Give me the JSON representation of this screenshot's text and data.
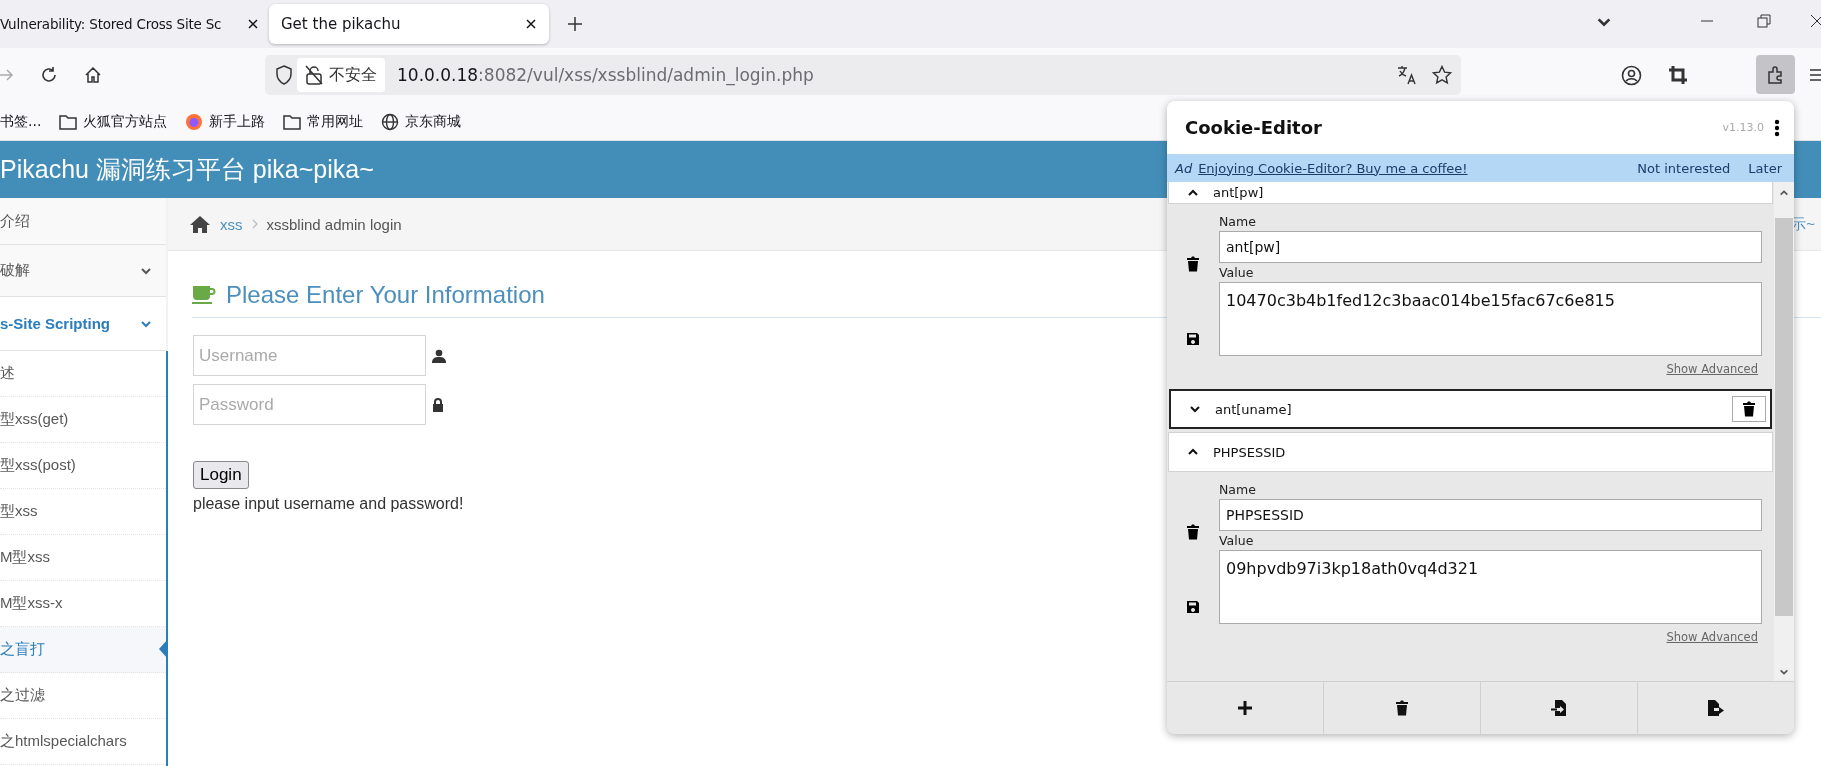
{
  "browser": {
    "tabs": [
      {
        "title": "Vulnerability: Stored Cross Site Sc",
        "selected": false
      },
      {
        "title": "Get the pikachu",
        "selected": true
      }
    ],
    "security_label": "不安全",
    "url_host": "10.0.0.18",
    "url_rest": ":8082/vul/xss/xssblind/admin_login.php",
    "bookmarks": [
      {
        "label": "书签...",
        "kind": "plain"
      },
      {
        "label": "火狐官方站点",
        "kind": "folder"
      },
      {
        "label": "新手上路",
        "kind": "firefox"
      },
      {
        "label": "常用网址",
        "kind": "folder"
      },
      {
        "label": "京东商城",
        "kind": "globe"
      }
    ]
  },
  "site": {
    "title": "Pikachu 漏洞练习平台 pika~pika~",
    "sidebar": [
      {
        "label": "介绍",
        "kind": "link",
        "selected": false
      },
      {
        "label": "破解",
        "kind": "group",
        "selected": false
      },
      {
        "label": "s-Site Scripting",
        "kind": "group",
        "selected": true,
        "children": [
          {
            "label": "述",
            "selected": false
          },
          {
            "label": "型xss(get)",
            "selected": false
          },
          {
            "label": "型xss(post)",
            "selected": false
          },
          {
            "label": "型xss",
            "selected": false
          },
          {
            "label": "M型xss",
            "selected": false
          },
          {
            "label": "M型xss-x",
            "selected": false
          },
          {
            "label": "之盲打",
            "selected": true
          },
          {
            "label": "之过滤",
            "selected": false
          },
          {
            "label": "之htmlspecialchars",
            "selected": false
          }
        ]
      }
    ],
    "breadcrumb": {
      "link": "xss",
      "current": "xssblind admin login",
      "trailing": "示~"
    },
    "form": {
      "heading": "Please Enter Your Information",
      "fields": [
        {
          "placeholder": "Username",
          "kind": "user"
        },
        {
          "placeholder": "Password",
          "kind": "password"
        }
      ],
      "button": "Login",
      "message": "please input username and password!"
    }
  },
  "cookie_editor": {
    "title": "Cookie-Editor",
    "version": "v1.13.0",
    "ad": {
      "tag": "Ad",
      "link": "Enjoying Cookie-Editor? Buy me a coffee!",
      "dismiss": "Not interested",
      "later": "Later"
    },
    "cookies": [
      {
        "name": "ant[pw]",
        "expanded": true,
        "focused": false,
        "name_label": "Name",
        "name_value": "ant[pw]",
        "value_label": "Value",
        "value": "10470c3b4b1fed12c3baac014be15fac67c6e815",
        "advanced": "Show Advanced"
      },
      {
        "name": "ant[uname]",
        "expanded": false,
        "focused": true
      },
      {
        "name": "PHPSESSID",
        "expanded": true,
        "focused": false,
        "name_label": "Name",
        "name_value": "PHPSESSID",
        "value_label": "Value",
        "value": "09hpvdb97i3kp18ath0vq4d321",
        "advanced": "Show Advanced"
      }
    ]
  }
}
